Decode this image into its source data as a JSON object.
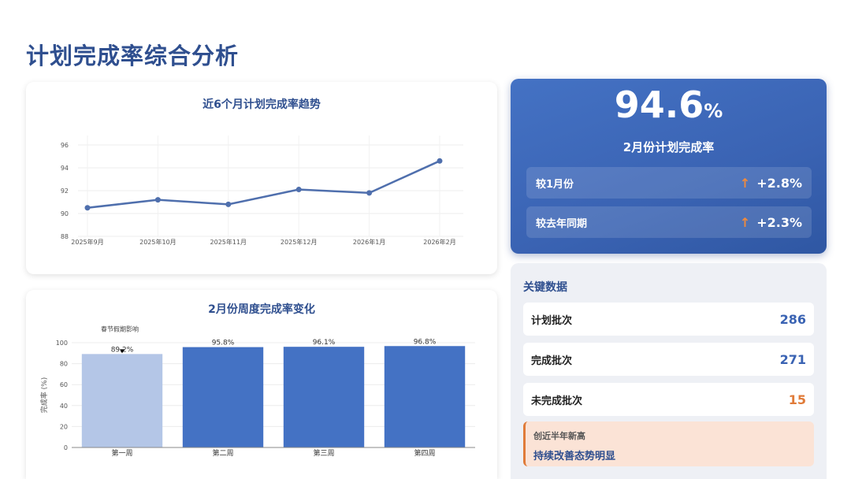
{
  "page": {
    "title": "计划完成率综合分析"
  },
  "kpi": {
    "value": "94.6",
    "unit": "%",
    "label": "2月份计划完成率",
    "rows": [
      {
        "label": "较1月份",
        "arrow": "↑",
        "value": "+2.8%"
      },
      {
        "label": "较去年同期",
        "arrow": "↑",
        "value": "+2.3%"
      }
    ]
  },
  "key_data": {
    "title": "关键数据",
    "rows": [
      {
        "label": "计划批次",
        "value": "286"
      },
      {
        "label": "完成批次",
        "value": "271"
      },
      {
        "label": "未完成批次",
        "value": "15"
      }
    ],
    "note": {
      "line1": "创近半年新高",
      "line2": "持续改善态势明显"
    }
  },
  "colors": {
    "line": "#4f6fad",
    "bar": "#4472c4",
    "bar_highlight": "#b4c6e7",
    "accent": "#e07b39"
  },
  "chart_data": [
    {
      "type": "line",
      "title": "近6个月计划完成率趋势",
      "x": [
        "2025年9月",
        "2025年10月",
        "2025年11月",
        "2025年12月",
        "2026年1月",
        "2026年2月"
      ],
      "series": [
        {
          "values": [
            90.5,
            91.2,
            90.8,
            92.1,
            91.8,
            94.6
          ]
        }
      ],
      "ylim": [
        88,
        96
      ],
      "yticks": [
        88,
        90,
        92,
        94,
        96
      ],
      "grid": true
    },
    {
      "type": "bar",
      "title": "2月份周度完成率变化",
      "categories": [
        "第一周",
        "第二周",
        "第三周",
        "第四周"
      ],
      "values": [
        89.2,
        95.8,
        96.1,
        96.8
      ],
      "data_labels": [
        "89.2%",
        "95.8%",
        "96.1%",
        "96.8%"
      ],
      "ylabel": "完成率 (%)",
      "ylim": [
        0,
        100
      ],
      "yticks": [
        0,
        20,
        40,
        60,
        80,
        100
      ],
      "annotation": {
        "text": "春节假期影响",
        "category": "第一周"
      },
      "grid": true
    }
  ]
}
